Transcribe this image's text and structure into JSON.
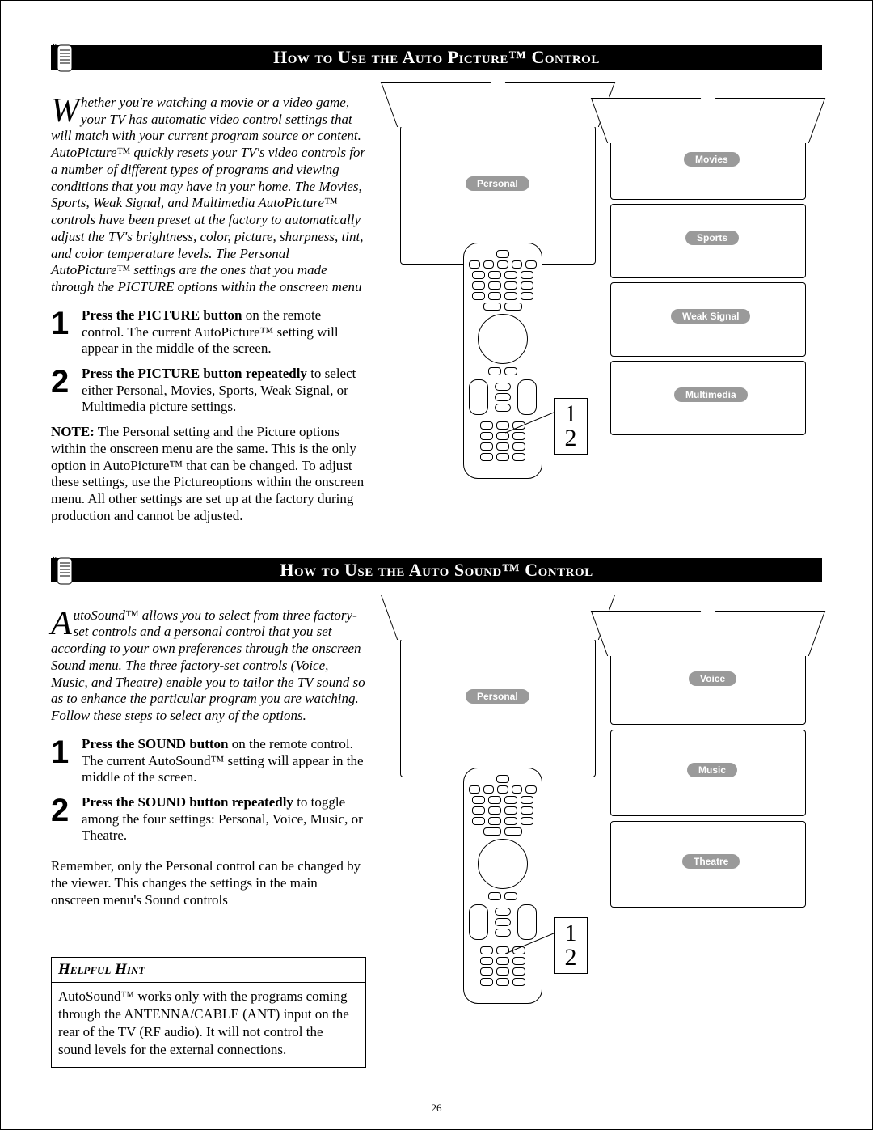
{
  "page_number": "26",
  "section1": {
    "title_html": "How to Use the Auto Picture™ Control",
    "intro": "Whether you're watching a movie or a video game, your TV has automatic video control settings that will match with your current program source or content. AutoPicture™ quickly resets your TV's video controls for a number of different types of programs and viewing conditions that you may have in your home. The Movies, Sports, Weak Signal, and Multimedia AutoPicture™ controls have been preset at the factory to automatically adjust the TV's brightness, color, picture, sharpness, tint, and color temperature levels. The Personal AutoPicture™ settings are the ones that you made through the PICTURE options within the onscreen menu",
    "step1_bold": "Press the PICTURE button",
    "step1_rest": " on the remote control.  The current AutoPicture™ setting will appear in the middle of the screen.",
    "step2_bold": "Press the PICTURE button repeatedly",
    "step2_rest": " to select either Personal, Movies, Sports, Weak Signal, or Multimedia picture settings.",
    "note_label": "NOTE:",
    "note_body": "  The Personal setting and the Picture options within the onscreen menu are the same. This is the only option in AutoPicture™ that can be changed. To adjust these settings, use the Pictureoptions within the onscreen menu. All other settings are set up at the factory during production and cannot be adjusted.",
    "tv_labels": [
      "Personal",
      "Movies",
      "Sports",
      "Weak Signal",
      "Multimedia"
    ]
  },
  "section2": {
    "title_html": "How to Use the Auto Sound™ Control",
    "intro": "AutoSound™ allows you to select from three factory-set controls and a personal control that you set according to your own preferences through the onscreen Sound menu. The three factory-set controls (Voice, Music, and Theatre) enable you to tailor the TV sound so as to enhance the particular program you are watching. Follow these steps to select any of the options.",
    "step1_bold": "Press the SOUND button",
    "step1_rest": " on the remote control.  The current AutoSound™ setting will appear in the middle of the screen.",
    "step2_bold": "Press the SOUND button repeatedly",
    "step2_rest": " to toggle among the four settings:  Personal, Voice, Music, or Theatre.",
    "remember": "Remember, only the Personal control can be changed by the viewer.  This changes the settings in the main onscreen menu's Sound controls",
    "hint_title": "Helpful Hint",
    "hint_body": "AutoSound™ works only with the programs coming through the ANTENNA/CABLE (ANT) input on the rear of the TV (RF audio).  It will not control the sound levels for the external connections.",
    "tv_labels": [
      "Personal",
      "Voice",
      "Music",
      "Theatre"
    ]
  },
  "num1": "1",
  "num2": "2"
}
